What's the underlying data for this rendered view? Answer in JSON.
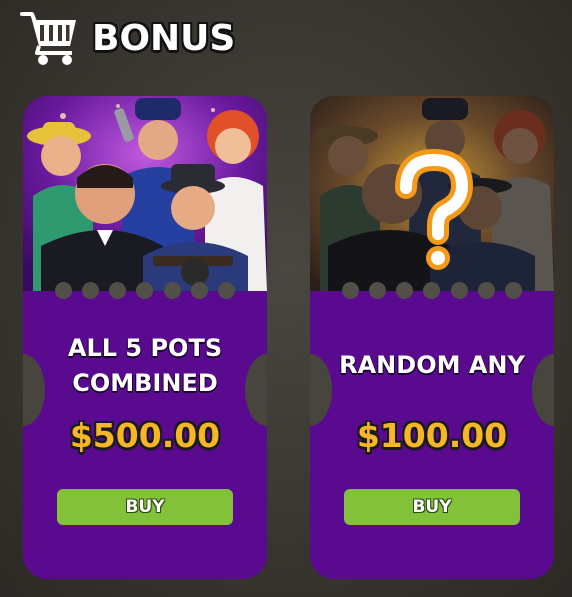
{
  "header": {
    "title": "BONUS",
    "icon": "cart-icon"
  },
  "colors": {
    "card_background": "#5a0a8e",
    "price": "#f6b626",
    "buy_button": "#84c13a",
    "page_background": "#3a3631"
  },
  "cards": [
    {
      "title_lines": [
        "ALL 5 POTS",
        "COMBINED"
      ],
      "price": "$500.00",
      "button_label": "BUY",
      "art": "mafia-gang-illustration"
    },
    {
      "title_lines": [
        "RANDOM ANY"
      ],
      "price": "$100.00",
      "button_label": "BUY",
      "art": "mystery-question-mark-illustration"
    }
  ]
}
